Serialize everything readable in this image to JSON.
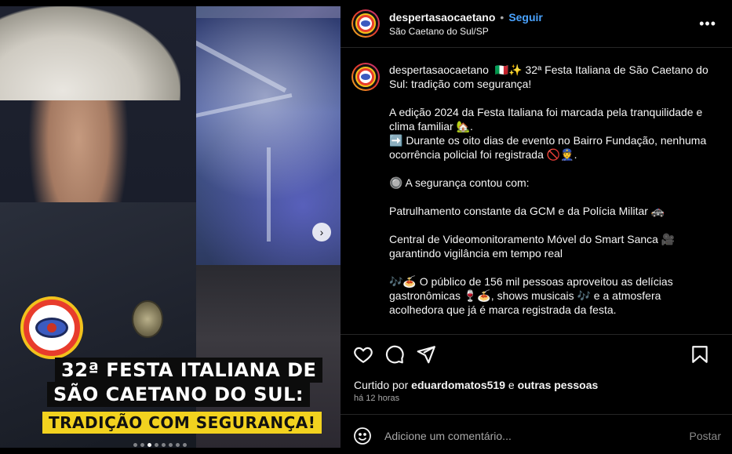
{
  "post": {
    "username": "despertasaocaetano",
    "separator": "•",
    "follow_label": "Seguir",
    "location": "São Caetano do Sul/SP",
    "more_label": "•••"
  },
  "media": {
    "overlay_line1": "32ª FESTA ITALIANA DE",
    "overlay_line2": "SÃO CAETANO DO SUL:",
    "overlay_line3": "TRADIÇÃO COM SEGURANÇA!",
    "next_label": "›",
    "slide_count": 8,
    "active_slide": 3
  },
  "caption": {
    "username": "despertasaocaetano",
    "line1": "🇮🇹✨ 32ª Festa Italiana de São Caetano do Sul: tradição com segurança!",
    "para2": "A edição 2024 da Festa Italiana foi marcada pela tranquilidade e clima familiar 🏡.",
    "para3": "➡️ Durante os oito dias de evento no Bairro Fundação, nenhuma ocorrência policial foi registrada 🚫👮.",
    "para4": "🔘 A segurança contou com:",
    "para5": "Patrulhamento constante da GCM e da Polícia Militar 🚓",
    "para6": "Central de Videomonitoramento Móvel do Smart Sanca 🎥 garantindo vigilância em tempo real",
    "para7": "🎶🍝 O público de 156 mil pessoas aproveitou as delícias gastronômicas 🍷🍝, shows musicais 🎶 e a atmosfera acolhedora que já é marca registrada da festa."
  },
  "actions": {
    "icons": [
      "heart-icon",
      "comment-icon",
      "share-icon",
      "bookmark-icon"
    ]
  },
  "likes": {
    "prefix": "Curtido por",
    "user": "eduardomatos519",
    "conj": "e",
    "others": "outras pessoas"
  },
  "time": "há 12 horas",
  "comment": {
    "placeholder": "Adicione um comentário...",
    "post_label": "Postar"
  },
  "colors": {
    "accent": "#4aa3ff",
    "background": "#000000",
    "overlay_yellow": "#f2d21f"
  }
}
